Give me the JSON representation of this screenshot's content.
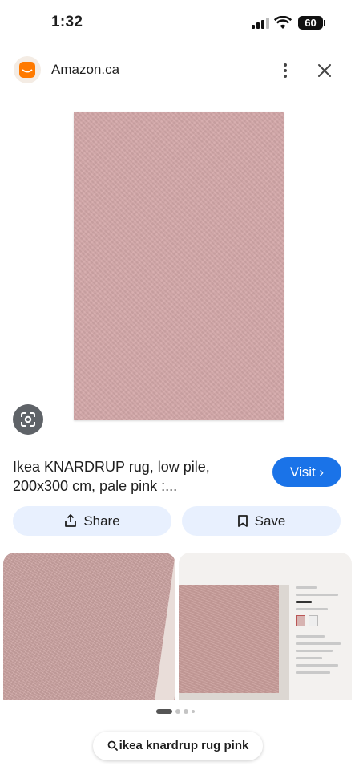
{
  "status_bar": {
    "time": "1:32",
    "battery": "60"
  },
  "header": {
    "site_name": "Amazon.ca",
    "site_icon": "amazon-logo-icon",
    "menu_icon": "more-vert-icon",
    "close_icon": "close-icon"
  },
  "result": {
    "title": "Ikea KNARDRUP rug, low pile, 200x300 cm, pale pink :...",
    "visit_label": "Visit ›",
    "share_label": "Share",
    "save_label": "Save"
  },
  "lens_icon": "lens-search-icon",
  "pagination": {
    "count": 4,
    "active_index": 0
  },
  "search": {
    "query": "ikea knardrup rug pink"
  },
  "colors": {
    "accent": "#1a73e8",
    "chip_bg": "#e8f0fe",
    "rug_pink": "#d4a8a9"
  }
}
